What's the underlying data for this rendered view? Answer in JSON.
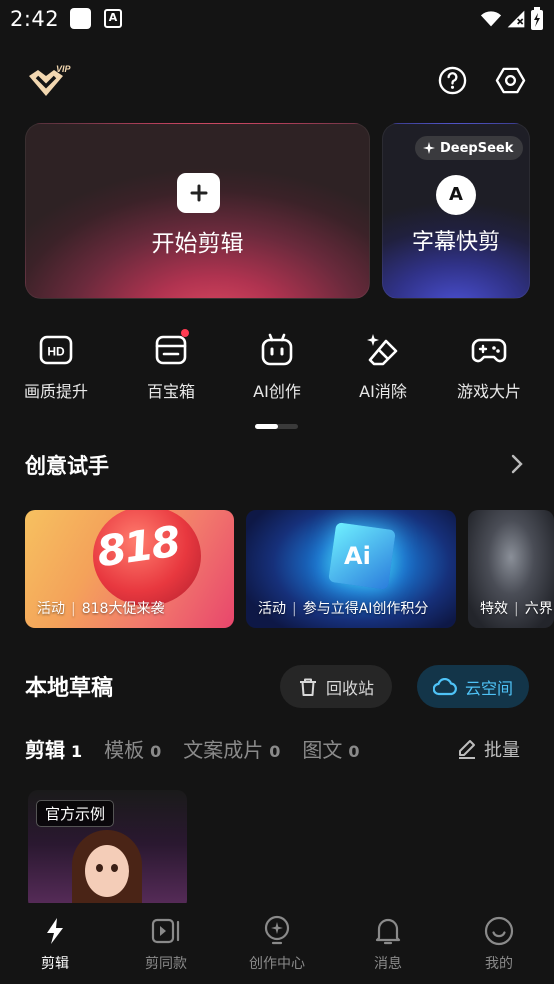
{
  "status_bar": {
    "time": "2:42",
    "notif_letter": "A"
  },
  "hero": {
    "start_title": "开始剪辑",
    "sub_badge": "DeepSeek",
    "sub_icon_letter": "A",
    "sub_title": "字幕快剪"
  },
  "tools": [
    {
      "label": "画质提升",
      "icon": "hd-icon"
    },
    {
      "label": "百宝箱",
      "icon": "toolbox-icon"
    },
    {
      "label": "AI创作",
      "icon": "robot-icon"
    },
    {
      "label": "AI消除",
      "icon": "eraser-icon"
    },
    {
      "label": "游戏大片",
      "icon": "gamepad-icon"
    }
  ],
  "creative": {
    "title": "创意试手",
    "cards": [
      {
        "tag": "活动",
        "text": "818大促来袭",
        "art": "818"
      },
      {
        "tag": "活动",
        "text": "参与立得AI创作积分",
        "art": "Ai"
      },
      {
        "tag": "特效",
        "text": "六界"
      }
    ]
  },
  "drafts": {
    "title": "本地草稿",
    "bin_label": "回收站",
    "cloud_label": "云空间",
    "tabs": [
      {
        "label": "剪辑",
        "count": "1"
      },
      {
        "label": "模板",
        "count": "0"
      },
      {
        "label": "文案成片",
        "count": "0"
      },
      {
        "label": "图文",
        "count": "0"
      }
    ],
    "batch_label": "批量",
    "item_tag": "官方示例"
  },
  "nav": [
    {
      "label": "剪辑"
    },
    {
      "label": "剪同款"
    },
    {
      "label": "创作中心"
    },
    {
      "label": "消息"
    },
    {
      "label": "我的"
    }
  ],
  "colors": {
    "accent_cloud": "#4fc3f7",
    "badge_red": "#ff3b52",
    "background": "#141414"
  }
}
